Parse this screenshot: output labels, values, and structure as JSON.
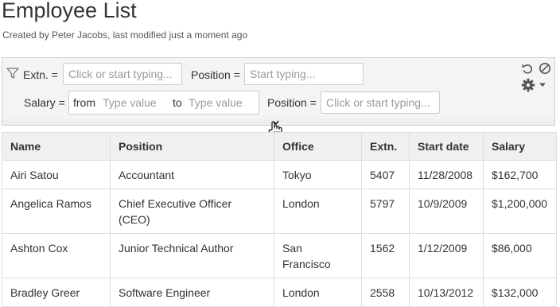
{
  "page": {
    "title": "Employee List",
    "byline": "Created by Peter Jacobs, last modified just a moment ago"
  },
  "filters": {
    "extn_label": "Extn. =",
    "extn_placeholder": "Click or start typing...",
    "position1_label": "Position =",
    "position1_placeholder": "Start typing...",
    "salary_label": "Salary =",
    "salary_from": "from",
    "salary_from_placeholder": "Type value",
    "salary_to": "to",
    "salary_to_placeholder": "Type value",
    "position2_label": "Position =",
    "position2_placeholder": "Click or start typing..."
  },
  "icons": {
    "filter": "filter-icon",
    "undo": "undo-icon",
    "clear": "clear-filter-icon",
    "settings": "gear-icon",
    "dropdown": "caret-down-icon",
    "cursor": "hand-pointer-cursor-icon"
  },
  "table": {
    "headers": [
      "Name",
      "Position",
      "Office",
      "Extn.",
      "Start date",
      "Salary"
    ],
    "rows": [
      [
        "Airi Satou",
        "Accountant",
        "Tokyo",
        "5407",
        "11/28/2008",
        "$162,700"
      ],
      [
        "Angelica Ramos",
        "Chief Executive Officer (CEO)",
        "London",
        "5797",
        "10/9/2009",
        "$1,200,000"
      ],
      [
        "Ashton Cox",
        "Junior Technical Author",
        "San Francisco",
        "1562",
        "1/12/2009",
        "$86,000"
      ],
      [
        "Bradley Greer",
        "Software Engineer",
        "London",
        "2558",
        "10/13/2012",
        "$132,000"
      ]
    ]
  }
}
